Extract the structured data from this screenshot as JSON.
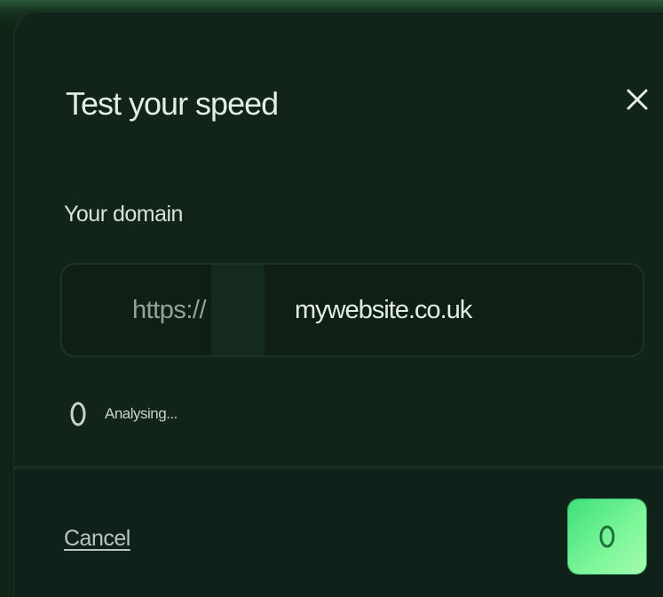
{
  "modal": {
    "title": "Test your speed",
    "close_icon": "close-icon",
    "domain_field": {
      "label": "Your domain",
      "prefix": "https://",
      "value": "mywebsite.co.uk",
      "placeholder": ""
    },
    "status": {
      "icon": "spinner-icon",
      "text": "Analysing..."
    },
    "footer": {
      "cancel_label": "Cancel",
      "submit_icon": "spinner-icon"
    }
  },
  "colors": {
    "background": "#12231a",
    "accent": "#5cee8a",
    "text": "#e4ece6"
  }
}
